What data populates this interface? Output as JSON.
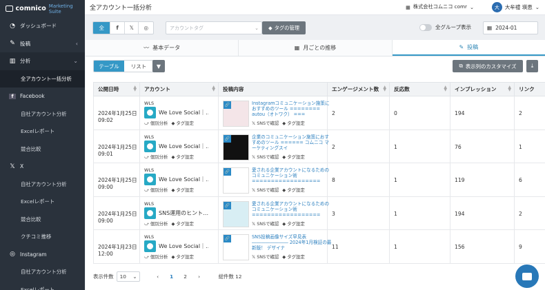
{
  "brand": {
    "name": "comnico",
    "suite": "Marketing Suite"
  },
  "sidebar": {
    "items": [
      {
        "label": "ダッシュボード",
        "icon": "dashboard-icon"
      },
      {
        "label": "投稿",
        "icon": "pencil-icon"
      },
      {
        "label": "分析",
        "icon": "chart-icon"
      }
    ],
    "sub_all": "全アカウント一括分析",
    "facebook": {
      "label": "Facebook",
      "subs": [
        "自社アカウント分析",
        "Excelレポート",
        "競合比較"
      ]
    },
    "x": {
      "label": "X",
      "subs": [
        "自社アカウント分析",
        "Excelレポート",
        "競合比較",
        "クチコミ推移"
      ]
    },
    "instagram": {
      "label": "Instagram",
      "subs": [
        "自社アカウント分析",
        "Excelレポート"
      ]
    }
  },
  "header": {
    "title": "全アカウント一括分析",
    "company": "株式会社コムニコ comr",
    "user": "大牟禮 瑛恵",
    "avatar": "大"
  },
  "filters": {
    "all": "全",
    "tag_placeholder": "アカウントタグ",
    "tag_manage": "タグの管理",
    "group_toggle": "全グループ表示",
    "month": "2024-01"
  },
  "tabs": [
    "基本データ",
    "月ごとの推移",
    "投稿"
  ],
  "view": {
    "table": "テーブル",
    "list": "リスト",
    "columns_btn": "表示列のカスタマイズ"
  },
  "columns": [
    "公開日時",
    "アカウント",
    "投稿内容",
    "エンゲージメント数",
    "反応数",
    "インプレッション",
    "リンク"
  ],
  "rows": [
    {
      "d1": "2024年1月25日",
      "d2": "09:02",
      "wls": "WLS",
      "acc": "We Love Social｜…",
      "post": "Instagramコミュニケーション施策におすすめのツール ======== autou（オトワク） ===",
      "net": "SNSで確認",
      "eng": "2",
      "rea": "0",
      "imp": "194",
      "link": "2"
    },
    {
      "d1": "2024年1月25日",
      "d2": "09:01",
      "wls": "WLS",
      "acc": "We Love Social｜…",
      "post": "企業のコミュニケーション施策におすすめのツール ====== コムニコ マーケティングスイ",
      "net": "SNSで確認",
      "eng": "2",
      "rea": "1",
      "imp": "76",
      "link": "1"
    },
    {
      "d1": "2024年1月25日",
      "d2": "09:00",
      "wls": "WLS",
      "acc": "We Love Social｜…",
      "post": "愛される企業アカウントになるための　　コミュニケーション術 ==================",
      "net": "SNSで確認",
      "eng": "8",
      "rea": "1",
      "imp": "119",
      "link": "6"
    },
    {
      "d1": "2024年1月25日",
      "d2": "09:00",
      "wls": "WLS",
      "acc": "SNS運用のヒント…",
      "post": "愛される企業アカウントになるための　　コミュニケーション術 ==================",
      "net": "SNSで確認",
      "eng": "3",
      "rea": "1",
      "imp": "194",
      "link": "2"
    },
    {
      "d1": "2024年1月23日",
      "d2": "12:00",
      "wls": "WLS",
      "acc": "We Love Social｜…",
      "post": "SNS投稿画像サイズ早見表 ―――――――― 2024年1月検証の最新版！ デザイナ",
      "net": "SNSで確認",
      "eng": "11",
      "rea": "1",
      "imp": "156",
      "link": "9"
    }
  ],
  "row_links": {
    "analysis": "個別分析",
    "tag": "タグ設定"
  },
  "footer": {
    "per_page_label": "表示件数",
    "per_page": "10",
    "pages": [
      "1",
      "2"
    ],
    "total": "総件数 12"
  }
}
